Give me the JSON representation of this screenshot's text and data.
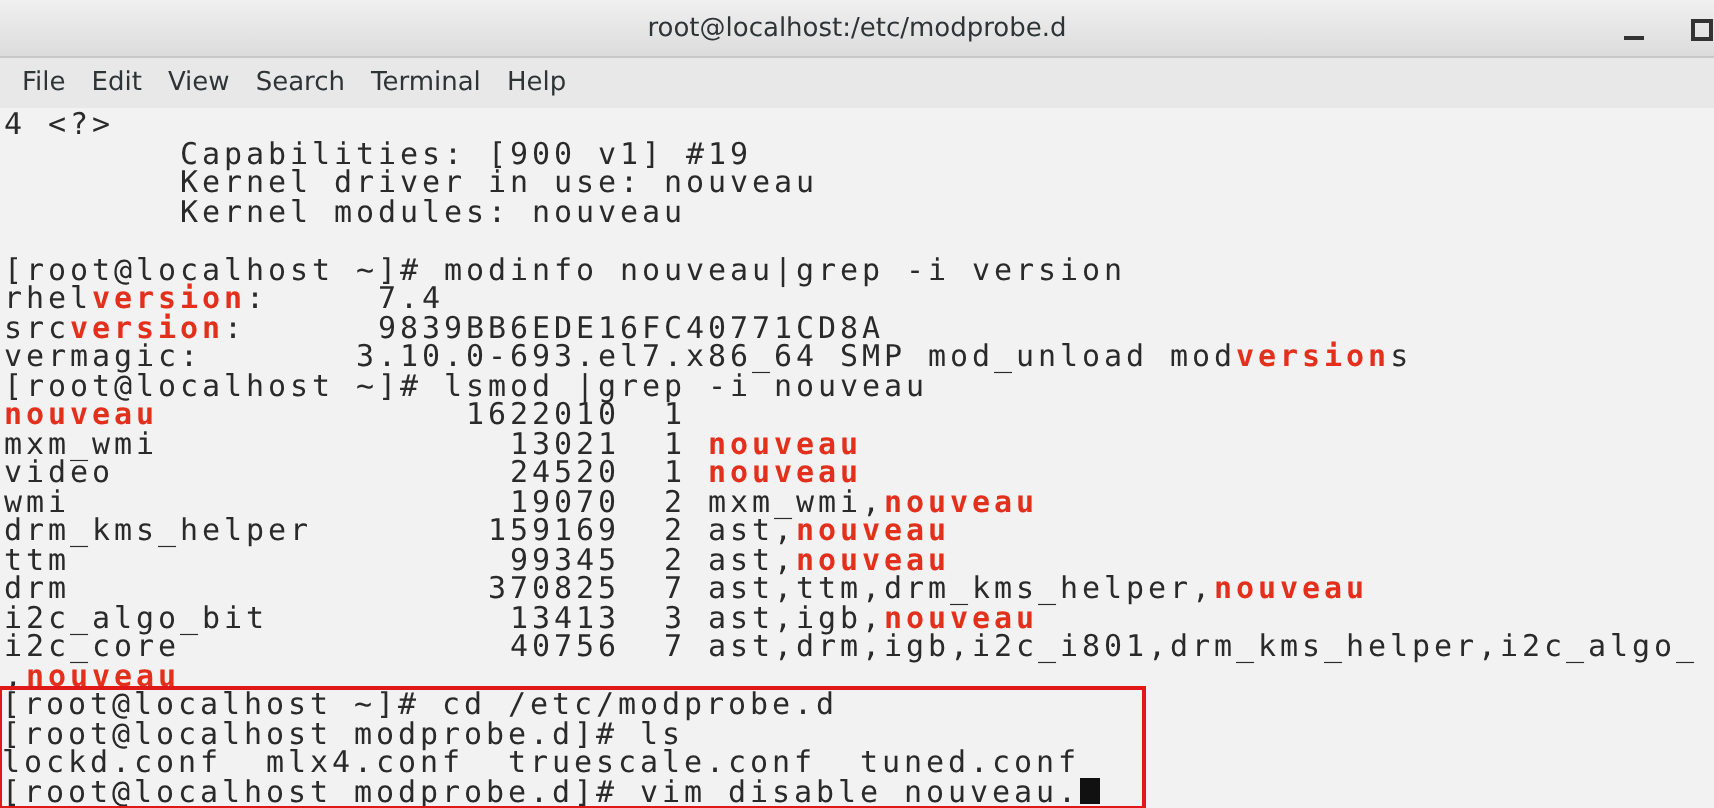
{
  "window": {
    "title": "root@localhost:/etc/modprobe.d"
  },
  "menu": [
    "File",
    "Edit",
    "View",
    "Search",
    "Terminal",
    "Help"
  ],
  "terminal": {
    "lines": [
      {
        "kind": "text",
        "boxed": false,
        "cursor": false,
        "segments": [
          {
            "text": "4 <?>",
            "highlighted": false
          }
        ]
      },
      {
        "kind": "text",
        "boxed": false,
        "cursor": false,
        "segments": [
          {
            "text": "        Capabilities: [900 v1] #19",
            "highlighted": false
          }
        ]
      },
      {
        "kind": "text",
        "boxed": false,
        "cursor": false,
        "segments": [
          {
            "text": "        Kernel driver in use: nouveau",
            "highlighted": false
          }
        ]
      },
      {
        "kind": "text",
        "boxed": false,
        "cursor": false,
        "segments": [
          {
            "text": "        Kernel modules: nouveau",
            "highlighted": false
          }
        ]
      },
      {
        "kind": "blank"
      },
      {
        "kind": "text",
        "boxed": false,
        "cursor": false,
        "segments": [
          {
            "text": "[root@localhost ~]# modinfo nouveau|grep -i version",
            "highlighted": false
          }
        ]
      },
      {
        "kind": "text",
        "boxed": false,
        "cursor": false,
        "segments": [
          {
            "text": "rhel",
            "highlighted": false
          },
          {
            "text": "version",
            "highlighted": true
          },
          {
            "text": ":     7.4",
            "highlighted": false
          }
        ]
      },
      {
        "kind": "text",
        "boxed": false,
        "cursor": false,
        "segments": [
          {
            "text": "src",
            "highlighted": false
          },
          {
            "text": "version",
            "highlighted": true
          },
          {
            "text": ":      9839BB6EDE16FC40771CD8A",
            "highlighted": false
          }
        ]
      },
      {
        "kind": "text",
        "boxed": false,
        "cursor": false,
        "segments": [
          {
            "text": "vermagic:       3.10.0-693.el7.x86_64 SMP mod_unload mod",
            "highlighted": false
          },
          {
            "text": "version",
            "highlighted": true
          },
          {
            "text": "s",
            "highlighted": false
          }
        ]
      },
      {
        "kind": "text",
        "boxed": false,
        "cursor": false,
        "segments": [
          {
            "text": "[root@localhost ~]# lsmod |grep -i nouveau",
            "highlighted": false
          }
        ]
      },
      {
        "kind": "text",
        "boxed": false,
        "cursor": false,
        "segments": [
          {
            "text": "nouveau",
            "highlighted": true
          },
          {
            "text": "              1622010  1",
            "highlighted": false
          }
        ]
      },
      {
        "kind": "text",
        "boxed": false,
        "cursor": false,
        "segments": [
          {
            "text": "mxm_wmi                13021  1 ",
            "highlighted": false
          },
          {
            "text": "nouveau",
            "highlighted": true
          }
        ]
      },
      {
        "kind": "text",
        "boxed": false,
        "cursor": false,
        "segments": [
          {
            "text": "video                  24520  1 ",
            "highlighted": false
          },
          {
            "text": "nouveau",
            "highlighted": true
          }
        ]
      },
      {
        "kind": "text",
        "boxed": false,
        "cursor": false,
        "segments": [
          {
            "text": "wmi                    19070  2 mxm_wmi,",
            "highlighted": false
          },
          {
            "text": "nouveau",
            "highlighted": true
          }
        ]
      },
      {
        "kind": "text",
        "boxed": false,
        "cursor": false,
        "segments": [
          {
            "text": "drm_kms_helper        159169  2 ast,",
            "highlighted": false
          },
          {
            "text": "nouveau",
            "highlighted": true
          }
        ]
      },
      {
        "kind": "text",
        "boxed": false,
        "cursor": false,
        "segments": [
          {
            "text": "ttm                    99345  2 ast,",
            "highlighted": false
          },
          {
            "text": "nouveau",
            "highlighted": true
          }
        ]
      },
      {
        "kind": "text",
        "boxed": false,
        "cursor": false,
        "segments": [
          {
            "text": "drm                   370825  7 ast,ttm,drm_kms_helper,",
            "highlighted": false
          },
          {
            "text": "nouveau",
            "highlighted": true
          }
        ]
      },
      {
        "kind": "text",
        "boxed": false,
        "cursor": false,
        "segments": [
          {
            "text": "i2c_algo_bit           13413  3 ast,igb,",
            "highlighted": false
          },
          {
            "text": "nouveau",
            "highlighted": true
          }
        ]
      },
      {
        "kind": "text",
        "boxed": false,
        "cursor": false,
        "segments": [
          {
            "text": "i2c_core               40756  7 ast,drm,igb,i2c_i801,drm_kms_helper,i2c_algo_",
            "highlighted": false
          }
        ]
      },
      {
        "kind": "text",
        "boxed": false,
        "cursor": false,
        "segments": [
          {
            "text": ",",
            "highlighted": false
          },
          {
            "text": "nouveau",
            "highlighted": true
          }
        ]
      },
      {
        "kind": "text",
        "boxed": true,
        "cursor": false,
        "segments": [
          {
            "text": "[root@localhost ~]# cd /etc/modprobe.d",
            "highlighted": false
          }
        ]
      },
      {
        "kind": "text",
        "boxed": true,
        "cursor": false,
        "segments": [
          {
            "text": "[root@localhost modprobe.d]# ls",
            "highlighted": false
          }
        ]
      },
      {
        "kind": "text",
        "boxed": true,
        "cursor": false,
        "segments": [
          {
            "text": "lockd.conf  mlx4.conf  truescale.conf  tuned.conf",
            "highlighted": false
          }
        ]
      },
      {
        "kind": "text",
        "boxed": true,
        "cursor": true,
        "segments": [
          {
            "text": "[root@localhost modprobe.d]# vim disable nouveau.",
            "highlighted": false
          }
        ]
      }
    ]
  }
}
